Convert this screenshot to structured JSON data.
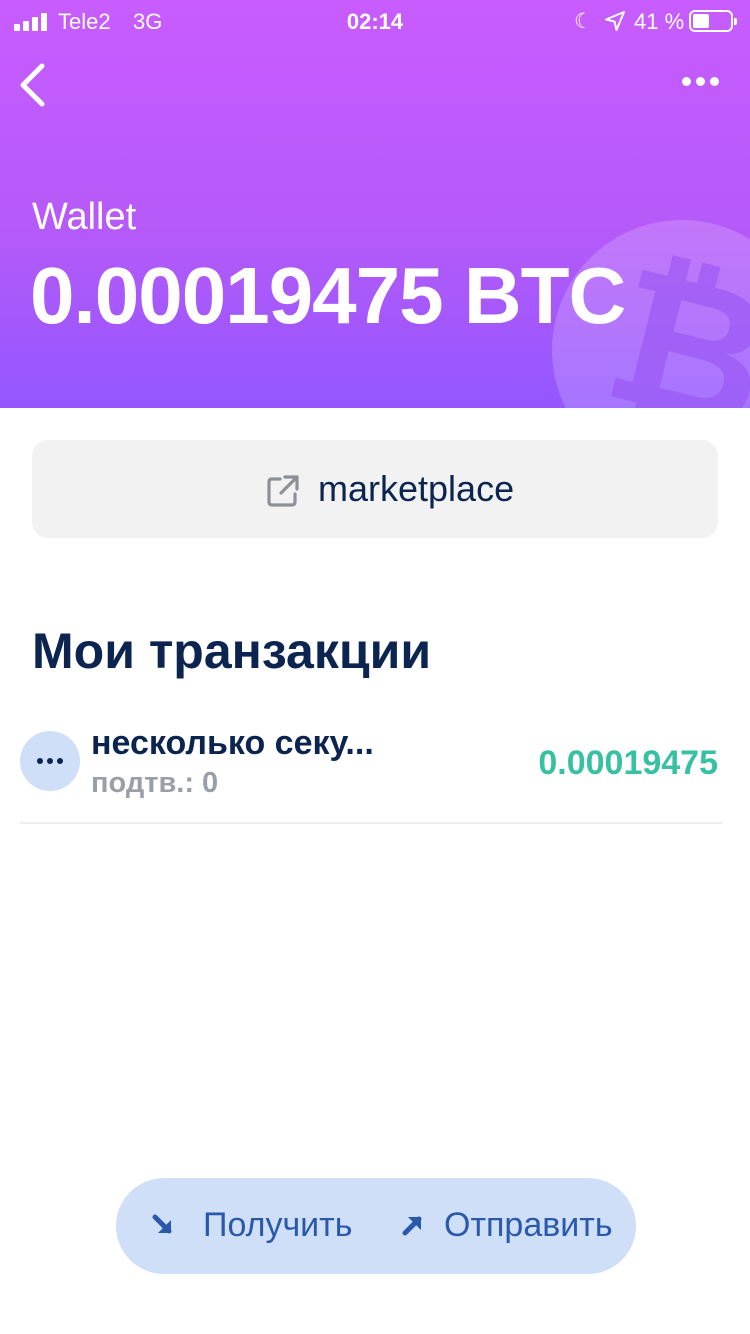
{
  "status_bar": {
    "carrier": "Tele2",
    "network": "3G",
    "time": "02:14",
    "battery_percent": "41 %",
    "icons": [
      "signal-icon",
      "moon-icon",
      "location-arrow-icon",
      "battery-icon"
    ]
  },
  "header": {
    "back_icon": "chevron-left-icon",
    "more_icon": "more-dots-icon",
    "wallet_label": "Wallet",
    "balance": "0.00019475 BTC",
    "watermark_icon": "bitcoin-icon",
    "colors": {
      "gradient_top": "#c85cff",
      "gradient_bottom": "#9357ff"
    }
  },
  "marketplace": {
    "icon": "external-link-icon",
    "label": "marketplace"
  },
  "transactions": {
    "title": "Мои транзакции",
    "items": [
      {
        "icon": "pending-dots-icon",
        "title": "несколько секу...",
        "subtitle": "подтв.: 0",
        "amount": "0.00019475"
      }
    ],
    "colors": {
      "amount": "#37c0a1",
      "text": "#0c2550"
    }
  },
  "actions": {
    "receive": {
      "icon": "arrow-down-right-icon",
      "label": "Получить"
    },
    "send": {
      "icon": "arrow-up-right-icon",
      "label": "Отправить"
    },
    "colors": {
      "background": "#cfdff7",
      "text": "#2a59ac"
    }
  }
}
